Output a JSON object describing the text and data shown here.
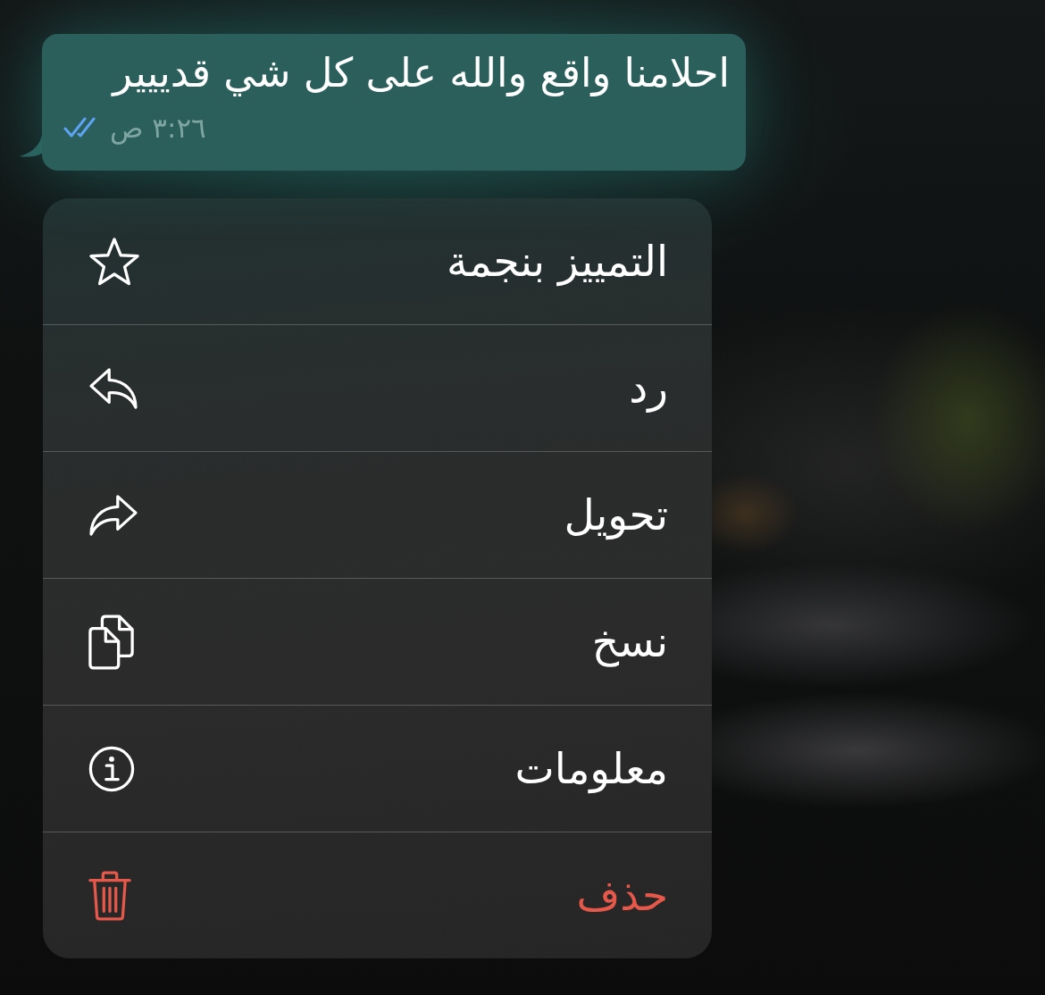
{
  "message": {
    "text": "احلامنا واقع والله على كل شي قدييير",
    "time": "٣:٢٦ ص",
    "read": true
  },
  "menu": {
    "items": [
      {
        "label": "التمييز بنجمة",
        "kind": "star",
        "destructive": false
      },
      {
        "label": "رد",
        "kind": "reply",
        "destructive": false
      },
      {
        "label": "تحويل",
        "kind": "forward",
        "destructive": false
      },
      {
        "label": "نسخ",
        "kind": "copy",
        "destructive": false
      },
      {
        "label": "معلومات",
        "kind": "info",
        "destructive": false
      },
      {
        "label": "حذف",
        "kind": "delete",
        "destructive": true
      }
    ]
  }
}
